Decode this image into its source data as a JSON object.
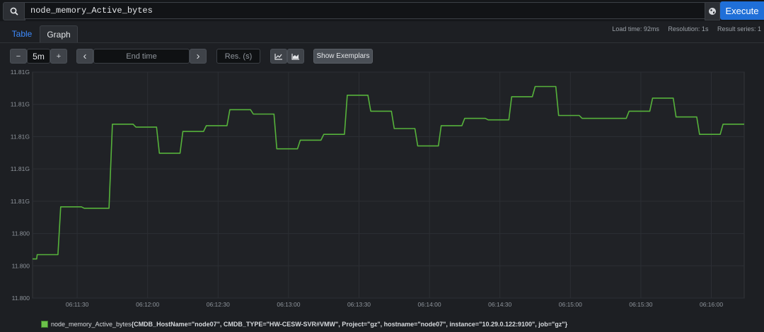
{
  "query": {
    "search_icon": "search-icon",
    "value": "node_memory_Active_bytes",
    "metrics_icon": "globe-icon",
    "execute_label": "Execute"
  },
  "tabs": [
    {
      "label": "Table"
    },
    {
      "label": "Graph"
    }
  ],
  "stats": {
    "load_time": "Load time: 92ms",
    "resolution": "Resolution: 1s",
    "result_series": "Result series: 1"
  },
  "controls": {
    "minus": "−",
    "range": "5m",
    "plus": "+",
    "prev": "‹",
    "end_time_placeholder": "End time",
    "next": "›",
    "res_placeholder": "Res. (s)",
    "line_icon": "line-chart-icon",
    "stacked_icon": "stacked-chart-icon",
    "exemplars_label": "Show Exemplars"
  },
  "chart_data": {
    "type": "line",
    "title": "",
    "xlabel": "",
    "ylabel": "",
    "y_tick_labels": [
      "11.81G",
      "11.81G",
      "11.81G",
      "11.81G",
      "11.81G",
      "11.800",
      "11.800",
      "11.800"
    ],
    "x_tick_labels": [
      "06:11:30",
      "06:12:00",
      "06:12:30",
      "06:13:00",
      "06:13:30",
      "06:14:00",
      "06:14:30",
      "06:15:00",
      "06:15:30",
      "06:16:00"
    ],
    "x_range": [
      "06:11:11",
      "06:16:14"
    ],
    "grid": true,
    "series": [
      {
        "color": "#56b23b",
        "x": [
          "06:11:11",
          "06:11:13",
          "06:11:23",
          "06:11:33",
          "06:11:45",
          "06:11:55",
          "06:12:05",
          "06:12:15",
          "06:12:25",
          "06:12:35",
          "06:12:45",
          "06:12:55",
          "06:13:05",
          "06:13:15",
          "06:13:25",
          "06:13:35",
          "06:13:45",
          "06:13:55",
          "06:14:05",
          "06:14:15",
          "06:14:25",
          "06:14:35",
          "06:14:45",
          "06:14:55",
          "06:15:05",
          "06:15:15",
          "06:15:25",
          "06:15:35",
          "06:15:45",
          "06:15:55",
          "06:16:05",
          "06:16:14"
        ],
        "values": [
          11.8029,
          11.8032,
          11.8065,
          11.8064,
          11.8122,
          11.812,
          11.8102,
          11.8117,
          11.8121,
          11.8132,
          11.8129,
          11.8105,
          11.8111,
          11.8115,
          11.8142,
          11.8131,
          11.8119,
          11.8107,
          11.8121,
          11.8126,
          11.8125,
          11.8141,
          11.8148,
          11.8128,
          11.8126,
          11.8126,
          11.8131,
          11.814,
          11.8127,
          11.8115,
          11.8122,
          11.8122
        ]
      }
    ]
  },
  "legend": {
    "metric": "node_memory_Active_bytes",
    "labels": "{CMDB_HostName=\"node07\", CMDB_TYPE=\"HW-CESW-SVR#VMW\", Project=\"gz\", hostname=\"node07\", instance=\"10.29.0.122:9100\", job=\"gz\"}"
  }
}
